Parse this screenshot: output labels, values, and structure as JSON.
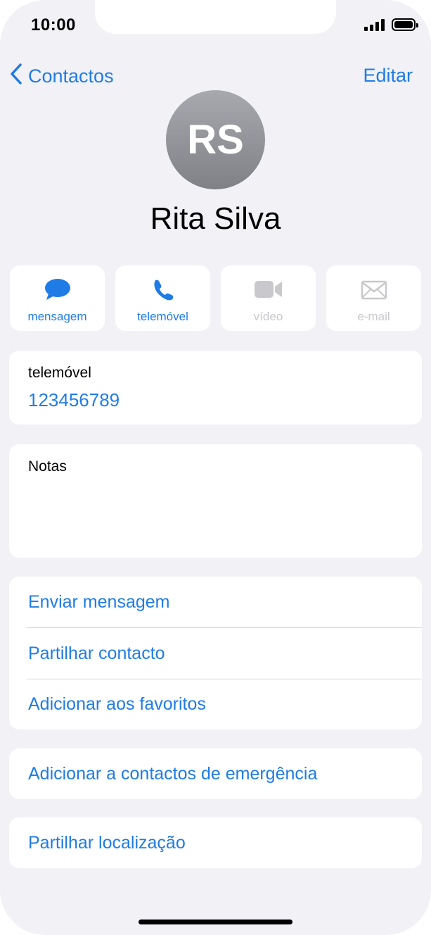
{
  "status": {
    "time": "10:00"
  },
  "nav": {
    "back_label": "Contactos",
    "edit_label": "Editar"
  },
  "contact": {
    "initials": "RS",
    "name": "Rita Silva"
  },
  "actions": [
    {
      "label": "mensagem",
      "icon": "message-bubble-icon",
      "enabled": true
    },
    {
      "label": "telemóvel",
      "icon": "phone-icon",
      "enabled": true
    },
    {
      "label": "vídeo",
      "icon": "video-camera-icon",
      "enabled": false
    },
    {
      "label": "e-mail",
      "icon": "envelope-icon",
      "enabled": false
    }
  ],
  "phone_field": {
    "label": "telemóvel",
    "value": "123456789"
  },
  "notes": {
    "label": "Notas"
  },
  "options": [
    "Enviar mensagem",
    "Partilhar contacto",
    "Adicionar aos favoritos"
  ],
  "emergency": {
    "label": "Adicionar a contactos de emergência"
  },
  "location": {
    "label": "Partilhar localização"
  },
  "colors": {
    "accent": "#1f7ce6",
    "background": "#f1f1f6",
    "disabled": "#c9c9cd"
  }
}
